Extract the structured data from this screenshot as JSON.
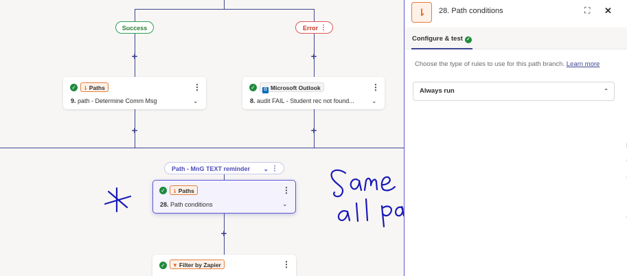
{
  "canvas": {
    "branches": {
      "success_label": "Success",
      "error_label": "Error"
    },
    "nodes": {
      "paths_node_9": {
        "tag": "Paths",
        "title_num": "9.",
        "title_text": "path - Determine Comm Msg"
      },
      "outlook_node_8": {
        "tag": "Microsoft Outlook",
        "title_num": "8.",
        "title_text": "audit FAIL - Student rec not found..."
      },
      "paths_node_28": {
        "tag": "Paths",
        "title_num": "28.",
        "title_text": "Path conditions"
      },
      "filter_node": {
        "tag": "Filter by Zapier"
      }
    },
    "path_pill_label": "Path - MnG TEXT reminder",
    "handwriting": "Same for all paths",
    "annotation_mark": "*"
  },
  "panel": {
    "title": "28. Path conditions",
    "tab_label": "Configure & test",
    "description": "Choose the type of rules to use for this path branch.",
    "learn_more": "Learn more",
    "rule_type_value": "Always run"
  },
  "colors": {
    "accent": "#3d4592",
    "selected_border": "#5b57d1",
    "success": "#2e9d57",
    "error": "#e05454",
    "paths_orange": "#e27d3f",
    "handwriting": "#1a1ab8"
  }
}
